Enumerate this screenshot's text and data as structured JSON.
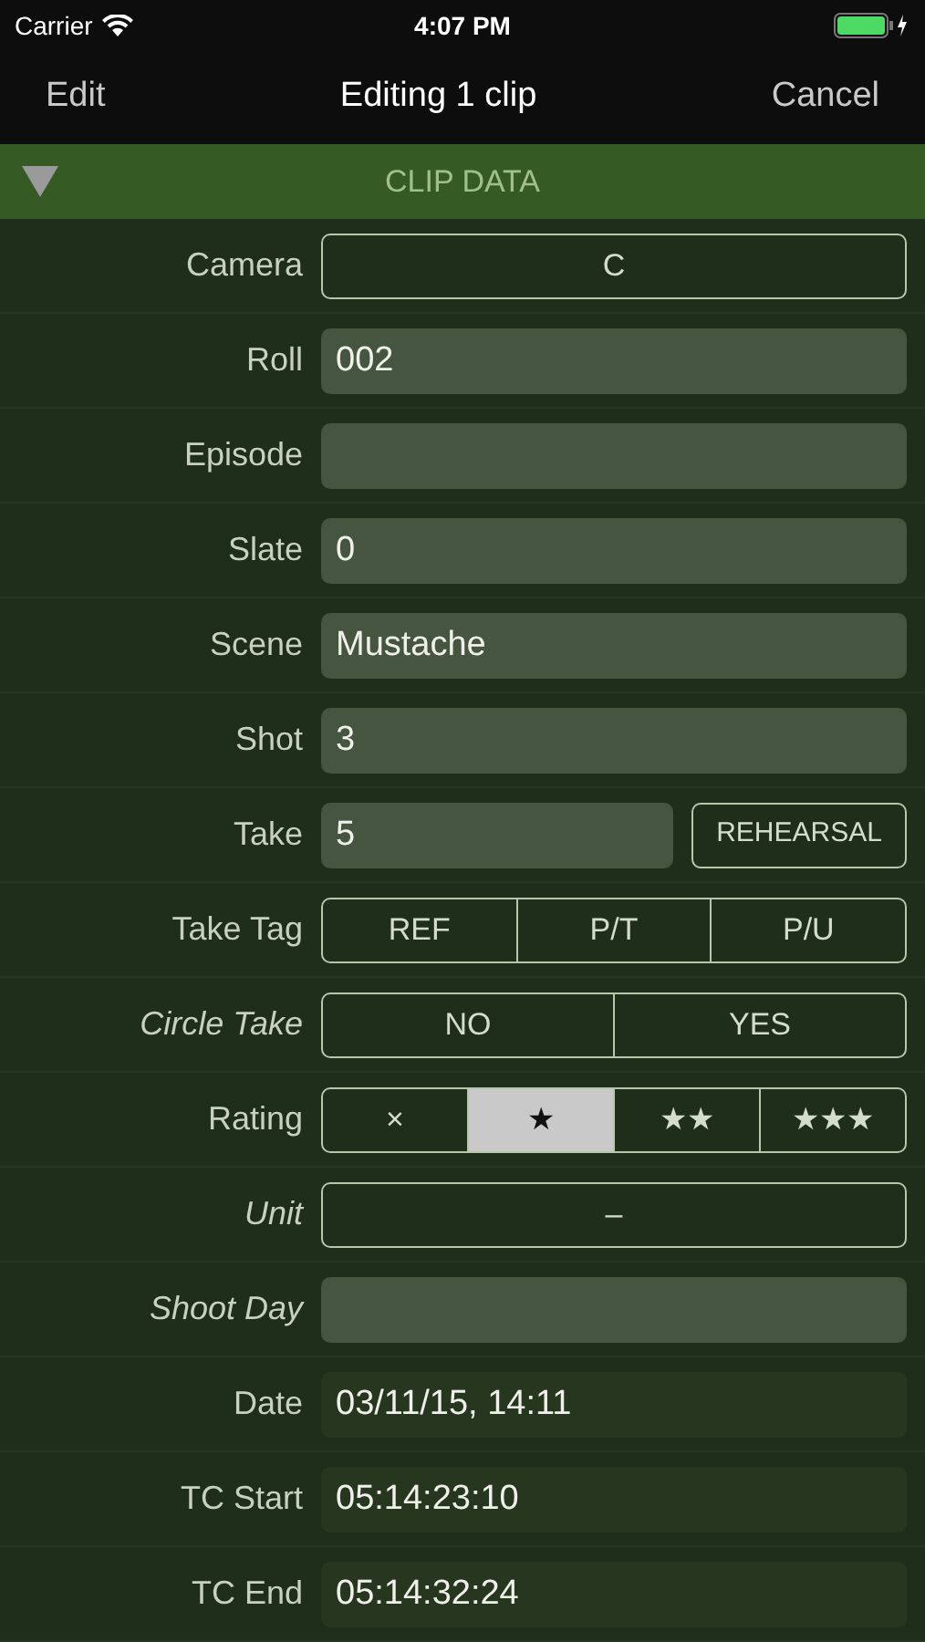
{
  "status_bar": {
    "carrier": "Carrier",
    "time": "4:07 PM"
  },
  "nav_bar": {
    "left": "Edit",
    "title": "Editing 1 clip",
    "right": "Cancel"
  },
  "section": {
    "title": "CLIP DATA",
    "expanded": true
  },
  "rows": [
    {
      "kind": "selector",
      "label": "Camera",
      "italic": false,
      "value": "C"
    },
    {
      "kind": "field",
      "label": "Roll",
      "italic": false,
      "value": "002"
    },
    {
      "kind": "field",
      "label": "Episode",
      "italic": false,
      "value": ""
    },
    {
      "kind": "field",
      "label": "Slate",
      "italic": false,
      "value": "0"
    },
    {
      "kind": "field",
      "label": "Scene",
      "italic": false,
      "value": "Mustache"
    },
    {
      "kind": "field",
      "label": "Shot",
      "italic": false,
      "value": "3"
    },
    {
      "kind": "field_button",
      "label": "Take",
      "italic": false,
      "value": "5",
      "button": "REHEARSAL"
    },
    {
      "kind": "segmented",
      "label": "Take Tag",
      "italic": false,
      "options": [
        {
          "label": "REF",
          "selected": false
        },
        {
          "label": "P/T",
          "selected": false
        },
        {
          "label": "P/U",
          "selected": false
        }
      ]
    },
    {
      "kind": "segmented",
      "label": "Circle Take",
      "italic": true,
      "options": [
        {
          "label": "NO",
          "selected": false
        },
        {
          "label": "YES",
          "selected": false
        }
      ]
    },
    {
      "kind": "segmented",
      "label": "Rating",
      "italic": false,
      "options": [
        {
          "label": "×",
          "selected": false
        },
        {
          "label": "★",
          "selected": true
        },
        {
          "label": "★★",
          "selected": false
        },
        {
          "label": "★★★",
          "selected": false
        }
      ]
    },
    {
      "kind": "selector",
      "label": "Unit",
      "italic": true,
      "value": "–"
    },
    {
      "kind": "field",
      "label": "Shoot Day",
      "italic": true,
      "value": ""
    },
    {
      "kind": "readonly",
      "label": "Date",
      "italic": false,
      "value": "03/11/15, 14:11"
    },
    {
      "kind": "readonly",
      "label": "TC Start",
      "italic": false,
      "value": "05:14:23:10"
    },
    {
      "kind": "readonly",
      "label": "TC End",
      "italic": false,
      "value": "05:14:32:24"
    }
  ]
}
